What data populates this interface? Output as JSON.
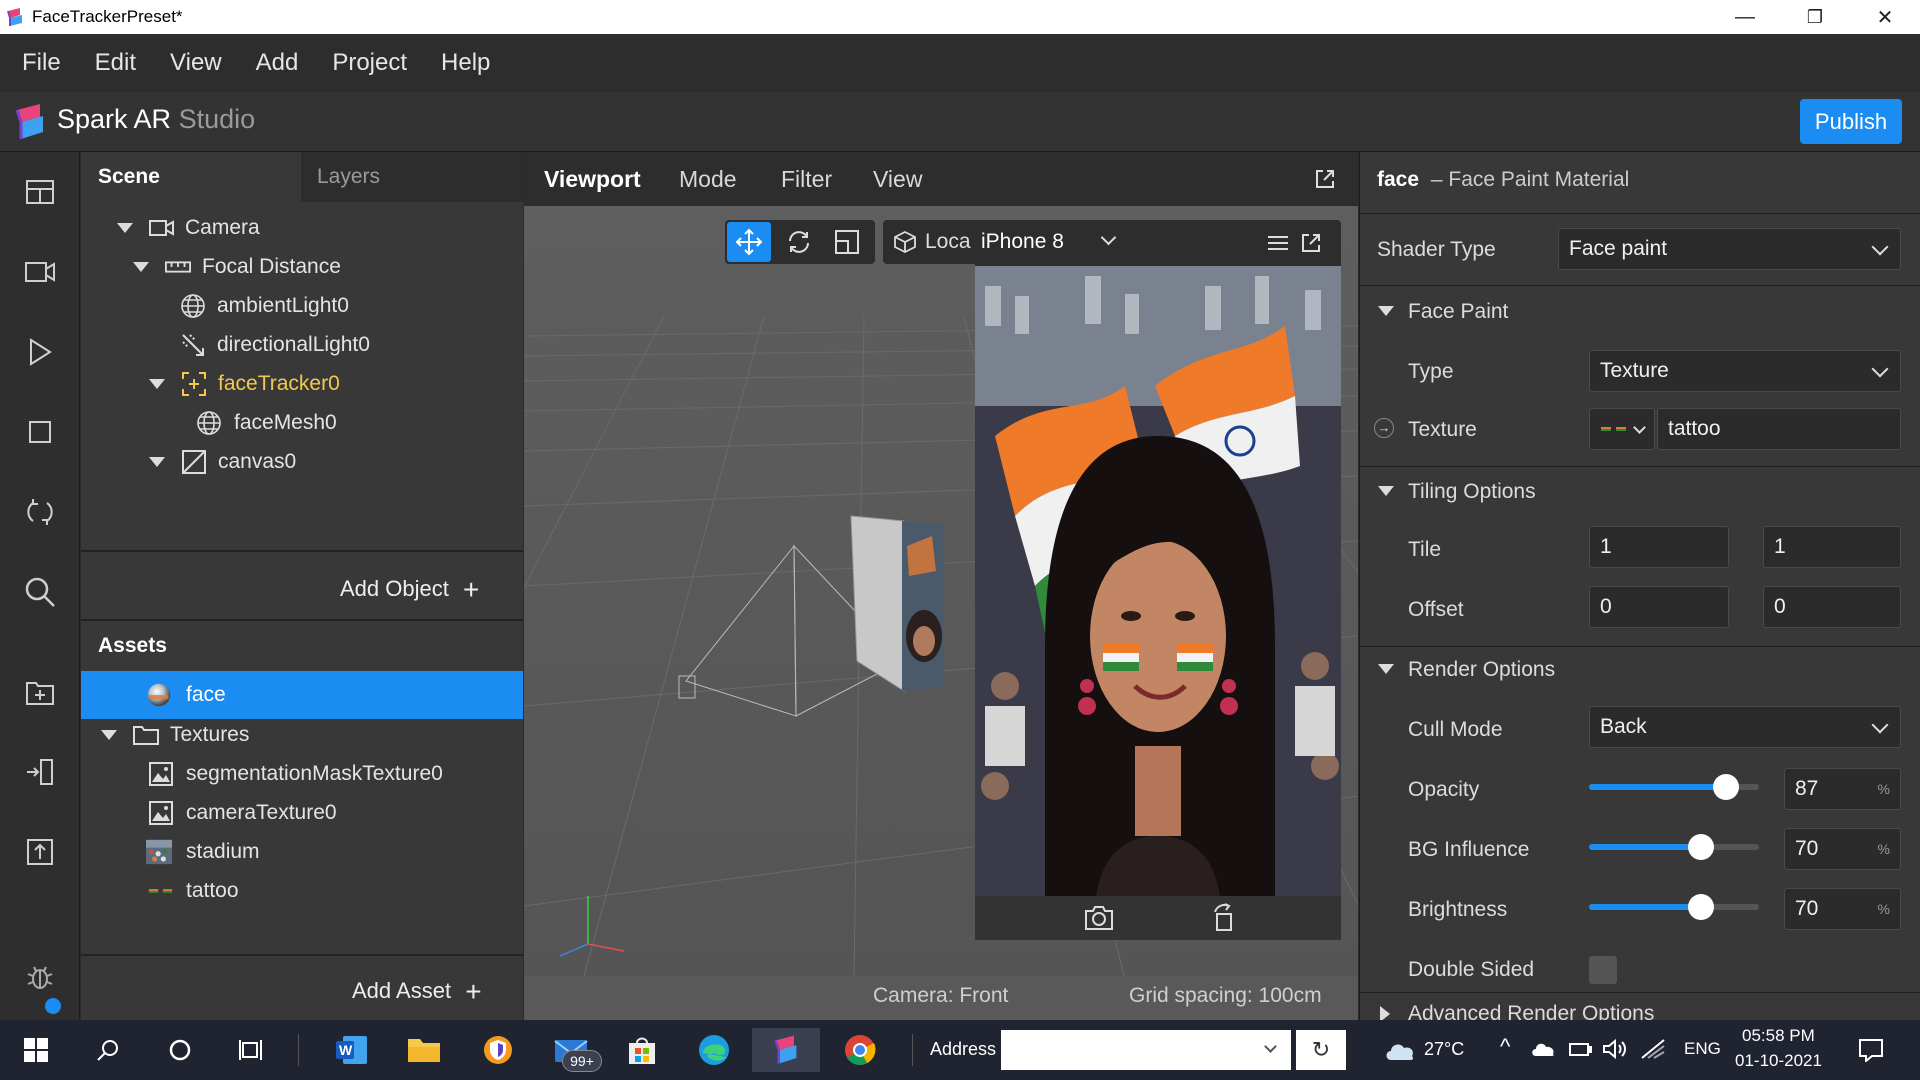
{
  "window": {
    "title": "FaceTrackerPreset*"
  },
  "menu": [
    "File",
    "Edit",
    "View",
    "Add",
    "Project",
    "Help"
  ],
  "app": {
    "brand": "Spark AR",
    "brand_suffix": "Studio",
    "publish_label": "Publish",
    "accent": "#1a8cf2"
  },
  "scene": {
    "tabs": [
      "Scene",
      "Layers"
    ],
    "tree": [
      {
        "label": "Camera",
        "icon": "camera-icon"
      },
      {
        "label": "Focal Distance",
        "icon": "ruler-icon"
      },
      {
        "label": "ambientLight0",
        "icon": "globe-light-icon"
      },
      {
        "label": "directionalLight0",
        "icon": "directional-light-icon"
      },
      {
        "label": "faceTracker0",
        "icon": "face-tracker-icon"
      },
      {
        "label": "faceMesh0",
        "icon": "mesh-icon"
      },
      {
        "label": "canvas0",
        "icon": "canvas-icon"
      }
    ],
    "add_object": "Add Object"
  },
  "assets": {
    "title": "Assets",
    "items": [
      {
        "label": "face",
        "icon": "material-sphere-icon",
        "selected": true
      },
      {
        "label": "Textures",
        "icon": "folder-icon"
      },
      {
        "label": "segmentationMaskTexture0",
        "icon": "image-icon"
      },
      {
        "label": "cameraTexture0",
        "icon": "image-icon"
      },
      {
        "label": "stadium",
        "icon": "stadium-thumb-icon"
      },
      {
        "label": "tattoo",
        "icon": "tattoo-thumb-icon"
      }
    ],
    "add_asset": "Add Asset"
  },
  "viewport": {
    "tabs": [
      "Viewport",
      "Mode",
      "Filter",
      "View"
    ],
    "local_label": "Loca",
    "device": "iPhone 8",
    "camera_label": "Camera: Front",
    "grid_label": "Grid spacing: 100cm"
  },
  "inspector": {
    "title": "face",
    "subtitle": "– Face Paint Material",
    "shader_type_label": "Shader Type",
    "shader_type_value": "Face paint",
    "face_paint_section": "Face Paint",
    "type_label": "Type",
    "type_value": "Texture",
    "texture_label": "Texture",
    "texture_value": "tattoo",
    "tiling_section": "Tiling Options",
    "tile_label": "Tile",
    "tile_x": "1",
    "tile_y": "1",
    "offset_label": "Offset",
    "offset_x": "0",
    "offset_y": "0",
    "render_section": "Render Options",
    "cull_label": "Cull Mode",
    "cull_value": "Back",
    "opacity_label": "Opacity",
    "opacity_value": "87",
    "bg_label": "BG Influence",
    "bg_value": "70",
    "brightness_label": "Brightness",
    "brightness_value": "70",
    "pct": "%",
    "double_sided_label": "Double Sided",
    "advanced_section": "Advanced Render Options"
  },
  "taskbar": {
    "address_label": "Address",
    "temperature": "27°C",
    "lang": "ENG",
    "time": "05:58 PM",
    "date": "01-10-2021",
    "badge": "99+"
  }
}
